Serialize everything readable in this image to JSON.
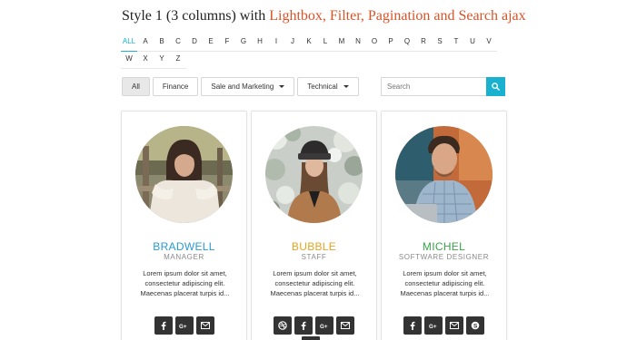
{
  "title": {
    "prefix": "Style 1 (3 columns) with ",
    "highlight": "Lightbox, Filter, Pagination and Search ajax"
  },
  "alphabet": [
    "ALL",
    "A",
    "B",
    "C",
    "D",
    "E",
    "F",
    "G",
    "H",
    "I",
    "J",
    "K",
    "L",
    "M",
    "N",
    "O",
    "P",
    "Q",
    "R",
    "S",
    "T",
    "U",
    "V",
    "W",
    "X",
    "Y",
    "Z"
  ],
  "alphabet_active": "ALL",
  "filters": [
    {
      "label": "All",
      "active": true,
      "dropdown": false
    },
    {
      "label": "Finance",
      "active": false,
      "dropdown": false
    },
    {
      "label": "Sale and Marketing",
      "active": false,
      "dropdown": true
    },
    {
      "label": "Technical",
      "active": false,
      "dropdown": true
    }
  ],
  "search": {
    "placeholder": "Search",
    "icon": "search-icon"
  },
  "colors": {
    "accent": "#1ab1d1",
    "title_highlight": "#d5542a"
  },
  "cards": [
    {
      "name": "BRADWELL",
      "name_color": "#2a9bd3",
      "role": "MANAGER",
      "description": "Lorem ipsum dolor sit amet, consectetur adipiscing elit. Maecenas placerat turpis id...",
      "socials": [
        "facebook-icon",
        "google-plus-icon",
        "email-icon"
      ]
    },
    {
      "name": "BUBBLE",
      "name_color": "#e8a321",
      "role": "STAFF",
      "description": "Lorem ipsum dolor sit amet, consectetur adipiscing elit. Maecenas placerat turpis id...",
      "socials": [
        "dribbble-icon",
        "facebook-icon",
        "google-plus-icon",
        "email-icon"
      ]
    },
    {
      "name": "MICHEL",
      "name_color": "#3aa14a",
      "role": "SOFTWARE DESIGNER",
      "description": "Lorem ipsum dolor sit amet, consectetur adipiscing elit. Maecenas placerat turpis id...",
      "socials": [
        "facebook-icon",
        "google-plus-icon",
        "email-icon",
        "skype-icon"
      ]
    }
  ]
}
